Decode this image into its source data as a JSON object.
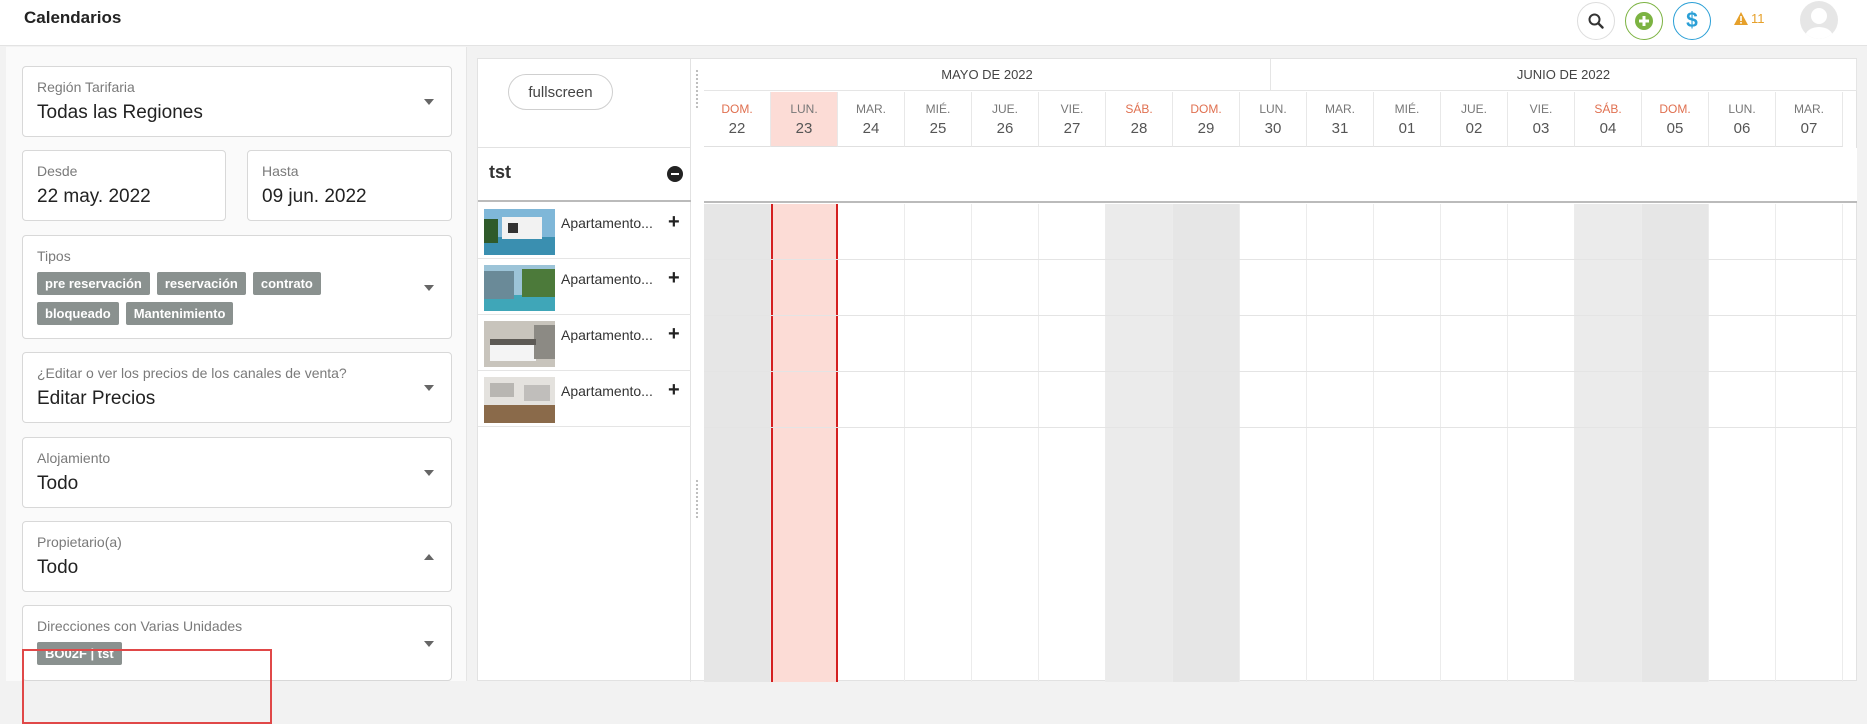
{
  "header": {
    "title": "Calendarios",
    "alert_count": "11"
  },
  "filters": {
    "region": {
      "label": "Región Tarifaria",
      "value": "Todas las Regiones"
    },
    "desde": {
      "label": "Desde",
      "value": "22 may. 2022"
    },
    "hasta": {
      "label": "Hasta",
      "value": "09 jun. 2022"
    },
    "tipos": {
      "label": "Tipos",
      "tags": [
        "pre reservación",
        "reservación",
        "contrato",
        "bloqueado",
        "Mantenimiento"
      ]
    },
    "precios": {
      "label": "¿Editar o ver los precios de los canales de venta?",
      "value": "Editar Precios"
    },
    "alojamiento": {
      "label": "Alojamiento",
      "value": "Todo"
    },
    "propietario": {
      "label": "Propietario(a)",
      "value": "Todo"
    },
    "direcciones": {
      "label": "Direcciones con Varias Unidades",
      "tag": "BO02F | tst"
    }
  },
  "calendar": {
    "fullscreen_label": "fullscreen",
    "group_name": "tst",
    "months": [
      {
        "label": "MAYO DE 2022"
      },
      {
        "label": "JUNIO DE 2022"
      }
    ],
    "days": [
      {
        "name": "DOM.",
        "num": "22"
      },
      {
        "name": "LUN.",
        "num": "23"
      },
      {
        "name": "MAR.",
        "num": "24"
      },
      {
        "name": "MIÉ.",
        "num": "25"
      },
      {
        "name": "JUE.",
        "num": "26"
      },
      {
        "name": "VIE.",
        "num": "27"
      },
      {
        "name": "SÁB.",
        "num": "28"
      },
      {
        "name": "DOM.",
        "num": "29"
      },
      {
        "name": "LUN.",
        "num": "30"
      },
      {
        "name": "MAR.",
        "num": "31"
      },
      {
        "name": "MIÉ.",
        "num": "01"
      },
      {
        "name": "JUE.",
        "num": "02"
      },
      {
        "name": "VIE.",
        "num": "03"
      },
      {
        "name": "SÁB.",
        "num": "04"
      },
      {
        "name": "DOM.",
        "num": "05"
      },
      {
        "name": "LUN.",
        "num": "06"
      },
      {
        "name": "MAR.",
        "num": "07"
      }
    ],
    "properties": [
      {
        "name": "Apartamento..."
      },
      {
        "name": "Apartamento..."
      },
      {
        "name": "Apartamento..."
      },
      {
        "name": "Apartamento..."
      }
    ]
  },
  "colors": {
    "accent_green": "#7cb342",
    "accent_blue": "#2a9fd6",
    "today_bg": "#fcdcd6",
    "today_line": "#d42020",
    "tag_bg": "#8a918f",
    "weekend_text": "#e07050"
  }
}
